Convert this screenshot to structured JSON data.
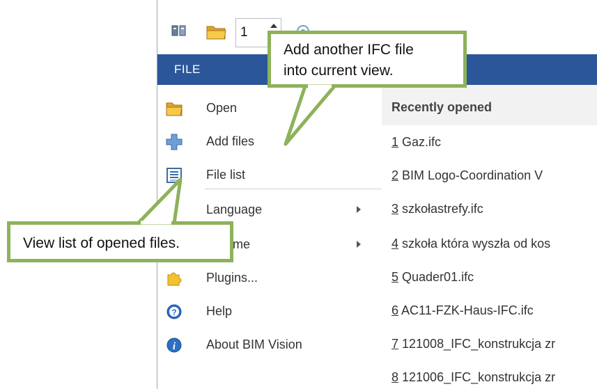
{
  "toolbar": {
    "spin_value": "1",
    "icons": [
      "models-icon",
      "open-folder-icon",
      "spin-up-icon",
      "view-icon"
    ]
  },
  "file_tab": {
    "label": "FILE"
  },
  "menu": {
    "items": [
      {
        "label": "Open",
        "icon": "open-folder-icon",
        "has_submenu": false
      },
      {
        "label": "Add files",
        "icon": "add-plus-icon",
        "has_submenu": false
      },
      {
        "label": "File list",
        "icon": "file-list-icon",
        "has_submenu": false
      },
      {
        "label": "Language",
        "icon": "language-icon",
        "has_submenu": true
      },
      {
        "label": "scheme",
        "icon": "color-scheme-icon",
        "has_submenu": true
      },
      {
        "label": "Plugins...",
        "icon": "puzzle-icon",
        "has_submenu": false
      },
      {
        "label": "Help",
        "icon": "help-icon",
        "has_submenu": false
      },
      {
        "label": "About BIM Vision",
        "icon": "info-icon",
        "has_submenu": false
      }
    ]
  },
  "recent": {
    "title": "Recently opened",
    "items": [
      {
        "num": "1",
        "name": " Gaz.ifc"
      },
      {
        "num": "2",
        "name": " BIM Logo-Coordination V"
      },
      {
        "num": "3",
        "name": " szkołastrefy.ifc"
      },
      {
        "num": "4",
        "name": " szkoła która wyszła od kos"
      },
      {
        "num": "5",
        "name": " Quader01.ifc"
      },
      {
        "num": "6",
        "name": " AC11-FZK-Haus-IFC.ifc"
      },
      {
        "num": "7",
        "name": " 121008_IFC_konstrukcja zr"
      },
      {
        "num": "8",
        "name": " 121006_IFC_konstrukcja zr"
      }
    ]
  },
  "callouts": {
    "top_line1": "Add another IFC file",
    "top_line2": "into current view.",
    "bottom": "View list of opened files."
  },
  "colors": {
    "accent_bar": "#2b579a",
    "callout_border": "#8db25a"
  }
}
